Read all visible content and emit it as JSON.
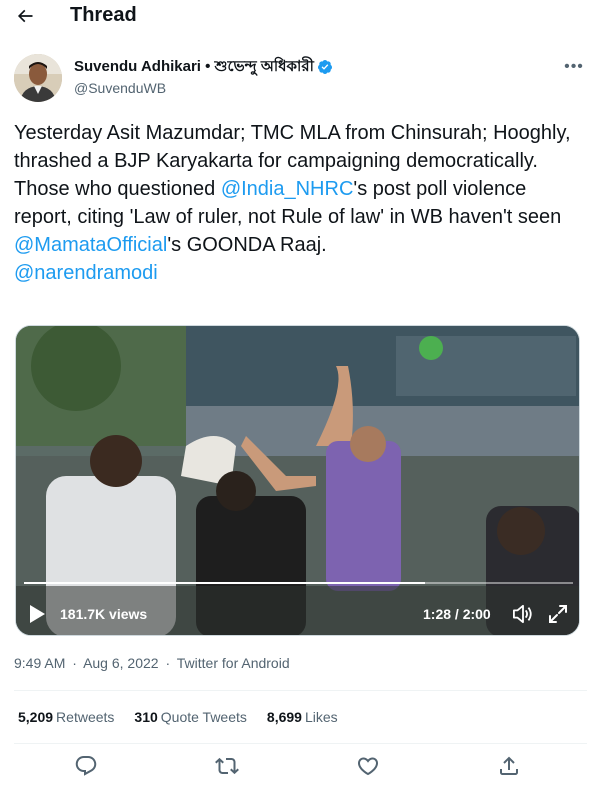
{
  "header": {
    "title": "Thread",
    "back_icon": "arrow-left-icon"
  },
  "tweet": {
    "author": {
      "name": "Suvendu Adhikari • শুভেন্দু অধিকারী",
      "handle": "@SuvenduWB",
      "verified": true
    },
    "text_segments": [
      {
        "text": "Yesterday Asit Mazumdar; TMC MLA from Chinsurah; Hooghly, thrashed a BJP Karyakarta for campaigning democratically.\nThose who questioned ",
        "link": false
      },
      {
        "text": "@India_NHRC",
        "link": true
      },
      {
        "text": "'s post poll violence report, citing 'Law of ruler, not Rule of law' in WB haven't seen ",
        "link": false
      },
      {
        "text": "@MamataOfficial",
        "link": true
      },
      {
        "text": "'s GOONDA Raaj.\n",
        "link": false
      },
      {
        "text": "@narendramodi",
        "link": true
      }
    ],
    "video": {
      "views": "181.7K views",
      "time": "1:28 / 2:00",
      "progress": 0.73
    },
    "time": "9:49 AM",
    "date": "Aug 6, 2022",
    "source": "Twitter for Android",
    "separator": "·",
    "stats": [
      {
        "count": "5,209",
        "label": "Retweets"
      },
      {
        "count": "310",
        "label": "Quote Tweets"
      },
      {
        "count": "8,699",
        "label": "Likes"
      }
    ]
  },
  "colors": {
    "link": "#1d9bf0",
    "secondary_text": "#536471",
    "primary_text": "#0f1419",
    "verified": "#1d9bf0"
  },
  "action_icons": [
    "reply-icon",
    "retweet-icon",
    "like-icon",
    "share-icon"
  ]
}
